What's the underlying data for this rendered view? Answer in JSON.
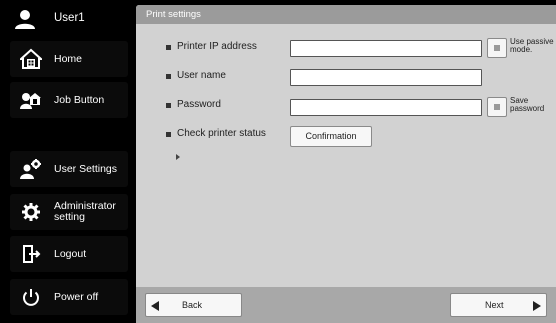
{
  "sidebar": {
    "user_label": "User1",
    "items": [
      {
        "label": "Home"
      },
      {
        "label": "Job Button"
      },
      {
        "label": "User Settings"
      },
      {
        "label_line1": "Administrator",
        "label_line2": "setting"
      },
      {
        "label": "Logout"
      },
      {
        "label": "Power off"
      }
    ]
  },
  "main": {
    "title": "Print settings",
    "fields": {
      "printer_ip": {
        "label": "Printer IP address",
        "value": ""
      },
      "user_name": {
        "label": "User name",
        "value": ""
      },
      "password": {
        "label": "Password",
        "value": ""
      },
      "check_status": {
        "label": "Check printer status",
        "button_label": "Confirmation"
      }
    },
    "passive_mode": {
      "line1": "Use passive",
      "line2": "mode."
    },
    "save_password": {
      "line1": "Save",
      "line2": "password"
    },
    "footer": {
      "back_label": "Back",
      "next_label": "Next"
    }
  },
  "colors": {
    "sidebar_bg": "#000000",
    "panel_bg": "#d2d2d2",
    "title_bar_bg": "#9b9b9b",
    "footer_bg": "#a8a8a8"
  },
  "icons": [
    "user-icon",
    "home-icon",
    "job-button-icon",
    "user-settings-icon",
    "gear-icon",
    "logout-icon",
    "power-icon"
  ]
}
